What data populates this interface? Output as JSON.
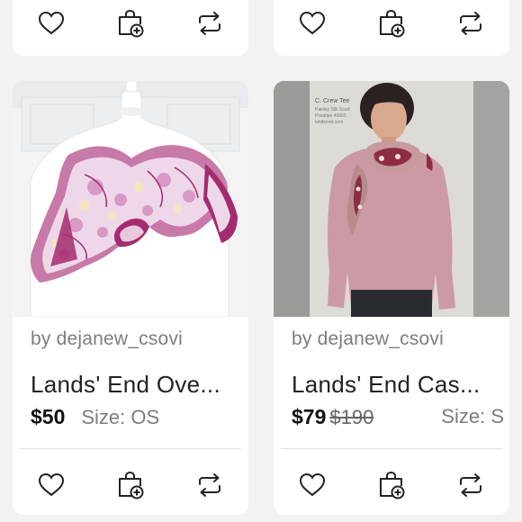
{
  "listings": [
    {
      "seller": "by dejanew_csovi",
      "title": "Lands' End Ove...",
      "price": "$50",
      "original_price": "",
      "size": "Size: OS"
    },
    {
      "seller": "by dejanew_csovi",
      "title": "Lands' End Cas...",
      "price": "$79",
      "original_price": "$190",
      "size": "Size: S"
    }
  ],
  "photo_overlay_text": [
    "C. Crew Tee",
    "Paisley Silk Scarf",
    "Pinstripe 40065",
    "landsend.com"
  ],
  "icons": {
    "like": "heart-icon",
    "bundle": "shopping-bag-plus-icon",
    "share": "repost-arrows-icon"
  },
  "colors": {
    "card": "#ffffff",
    "background": "#f2f2f2",
    "text_primary": "#222222",
    "text_secondary": "#7d7d7d",
    "scarf_accent": "#a32c6e"
  }
}
